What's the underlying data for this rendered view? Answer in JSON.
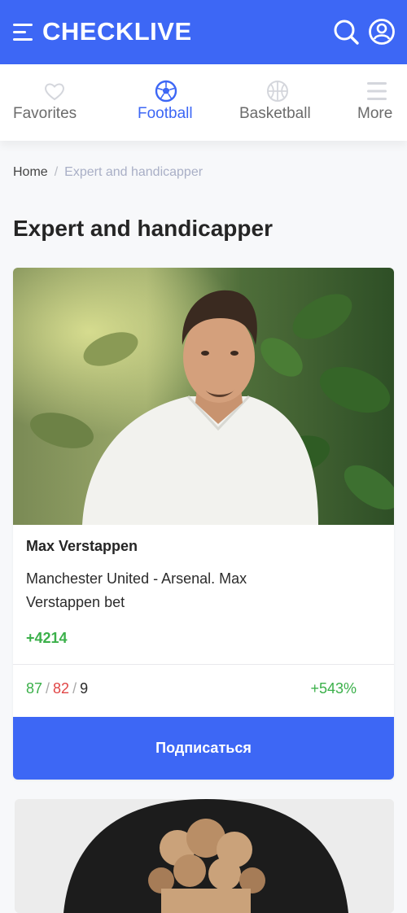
{
  "header": {
    "logo": "CHECKLIVE",
    "brand_color": "#3d67f5",
    "icons": [
      "menu-icon",
      "search-icon",
      "user-icon"
    ]
  },
  "nav": {
    "items": [
      {
        "label": "Favorites",
        "icon": "heart-icon",
        "active": false
      },
      {
        "label": "Football",
        "icon": "football-icon",
        "active": true
      },
      {
        "label": "Basketball",
        "icon": "basketball-icon",
        "active": false
      },
      {
        "label": "More",
        "icon": "menu-icon",
        "active": false
      }
    ]
  },
  "breadcrumb": {
    "home": "Home",
    "separator": "/",
    "current": "Expert and handicapper"
  },
  "page": {
    "title": "Expert and handicapper"
  },
  "experts": [
    {
      "name": "Max Verstappen",
      "match": "Manchester United - Arsenal. Max Verstappen bet",
      "points": "+4214",
      "wins": "87",
      "losses": "82",
      "draws": "9",
      "roi": "+543%",
      "subscribe_label": "Подписаться"
    }
  ],
  "colors": {
    "win": "#3bb04a",
    "loss": "#e04545",
    "accent": "#3d67f5"
  }
}
